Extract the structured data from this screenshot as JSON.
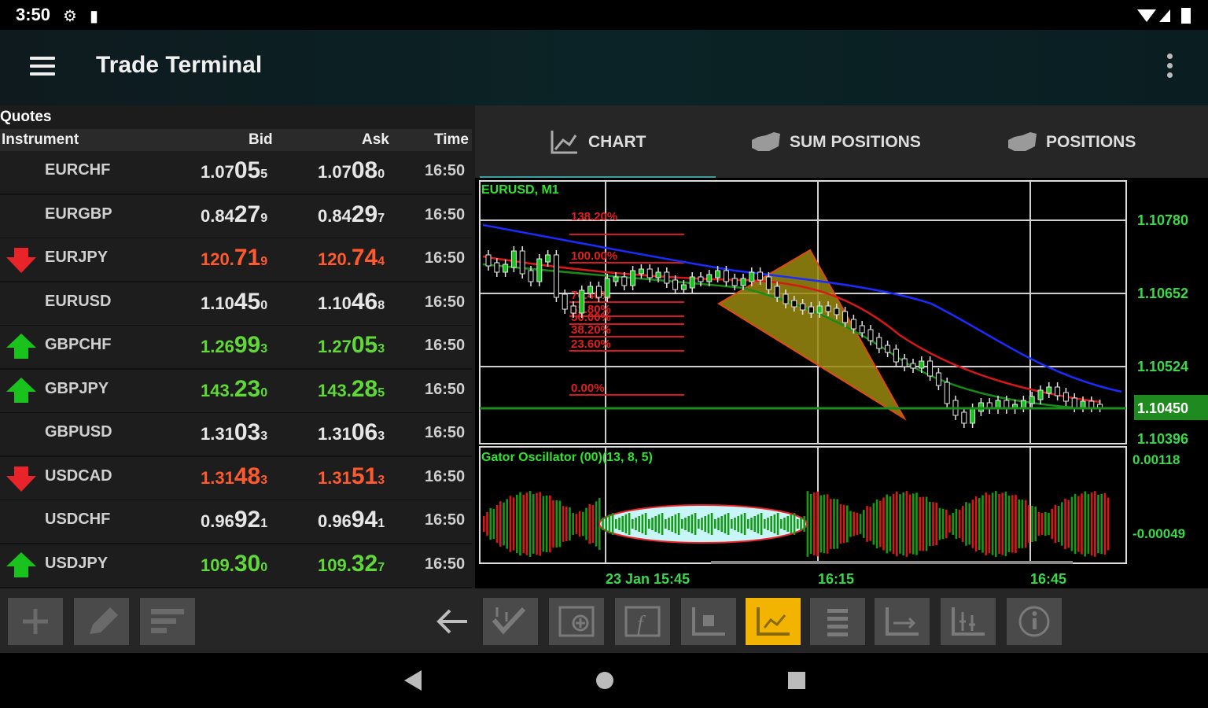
{
  "status": {
    "time": "3:50"
  },
  "app": {
    "title": "Trade Terminal"
  },
  "quotes": {
    "title": "Quotes",
    "columns": [
      "Instrument",
      "Bid",
      "Ask",
      "Time"
    ],
    "rows": [
      {
        "sym": "EURCHF",
        "dir": "none",
        "color": "white",
        "bid": [
          "1.07",
          "05",
          "5"
        ],
        "ask": [
          "1.07",
          "08",
          "0"
        ],
        "time": "16:50"
      },
      {
        "sym": "EURGBP",
        "dir": "none",
        "color": "white",
        "bid": [
          "0.84",
          "27",
          "9"
        ],
        "ask": [
          "0.84",
          "29",
          "7"
        ],
        "time": "16:50"
      },
      {
        "sym": "EURJPY",
        "dir": "down",
        "color": "red",
        "bid": [
          "120.",
          "71",
          "9"
        ],
        "ask": [
          "120.",
          "74",
          "4"
        ],
        "time": "16:50"
      },
      {
        "sym": "EURUSD",
        "dir": "none",
        "color": "white",
        "bid": [
          "1.10",
          "45",
          "0"
        ],
        "ask": [
          "1.10",
          "46",
          "8"
        ],
        "time": "16:50"
      },
      {
        "sym": "GBPCHF",
        "dir": "up",
        "color": "green",
        "bid": [
          "1.26",
          "99",
          "3"
        ],
        "ask": [
          "1.27",
          "05",
          "3"
        ],
        "time": "16:50"
      },
      {
        "sym": "GBPJPY",
        "dir": "up",
        "color": "green",
        "bid": [
          "143.",
          "23",
          "0"
        ],
        "ask": [
          "143.",
          "28",
          "5"
        ],
        "time": "16:50"
      },
      {
        "sym": "GBPUSD",
        "dir": "none",
        "color": "white",
        "bid": [
          "1.31",
          "03",
          "3"
        ],
        "ask": [
          "1.31",
          "06",
          "3"
        ],
        "time": "16:50"
      },
      {
        "sym": "USDCAD",
        "dir": "down",
        "color": "red",
        "bid": [
          "1.31",
          "48",
          "3"
        ],
        "ask": [
          "1.31",
          "51",
          "3"
        ],
        "time": "16:50"
      },
      {
        "sym": "USDCHF",
        "dir": "none",
        "color": "white",
        "bid": [
          "0.96",
          "92",
          "1"
        ],
        "ask": [
          "0.96",
          "94",
          "1"
        ],
        "time": "16:50"
      },
      {
        "sym": "USDJPY",
        "dir": "up",
        "color": "green",
        "bid": [
          "109.",
          "30",
          "0"
        ],
        "ask": [
          "109.",
          "32",
          "7"
        ],
        "time": "16:50"
      }
    ]
  },
  "tabs": {
    "chart": "CHART",
    "sum_positions": "SUM POSITIONS",
    "positions": "POSITIONS"
  },
  "chart": {
    "symbol_label": "EURUSD, M1",
    "price_labels": [
      "1.10780",
      "1.10652",
      "1.10524",
      "1.10450",
      "1.10396"
    ],
    "current_price": "1.10450",
    "fib_labels": [
      "138.20%",
      "100.00%",
      "76.40%",
      "61.80%",
      "50.00%",
      "38.20%",
      "23.60%",
      "0.00%"
    ],
    "oscillator_label": "Gator Oscillator (00)(13, 8, 5)",
    "oscillator_levels": [
      "0.00118",
      "-0.00049"
    ],
    "time_labels": [
      "23 Jan 15:45",
      "16:15",
      "16:45"
    ]
  },
  "toolbar": {
    "left": [
      "add",
      "edit",
      "sort"
    ],
    "right": [
      "trade",
      "indicator",
      "function",
      "objects",
      "chart-type",
      "list",
      "period",
      "bars",
      "info"
    ],
    "active": "chart-type"
  },
  "colors": {
    "up": "#19c21c",
    "down": "#e8242a",
    "accent": "#f2b400",
    "price_label": "#3bd84a"
  }
}
